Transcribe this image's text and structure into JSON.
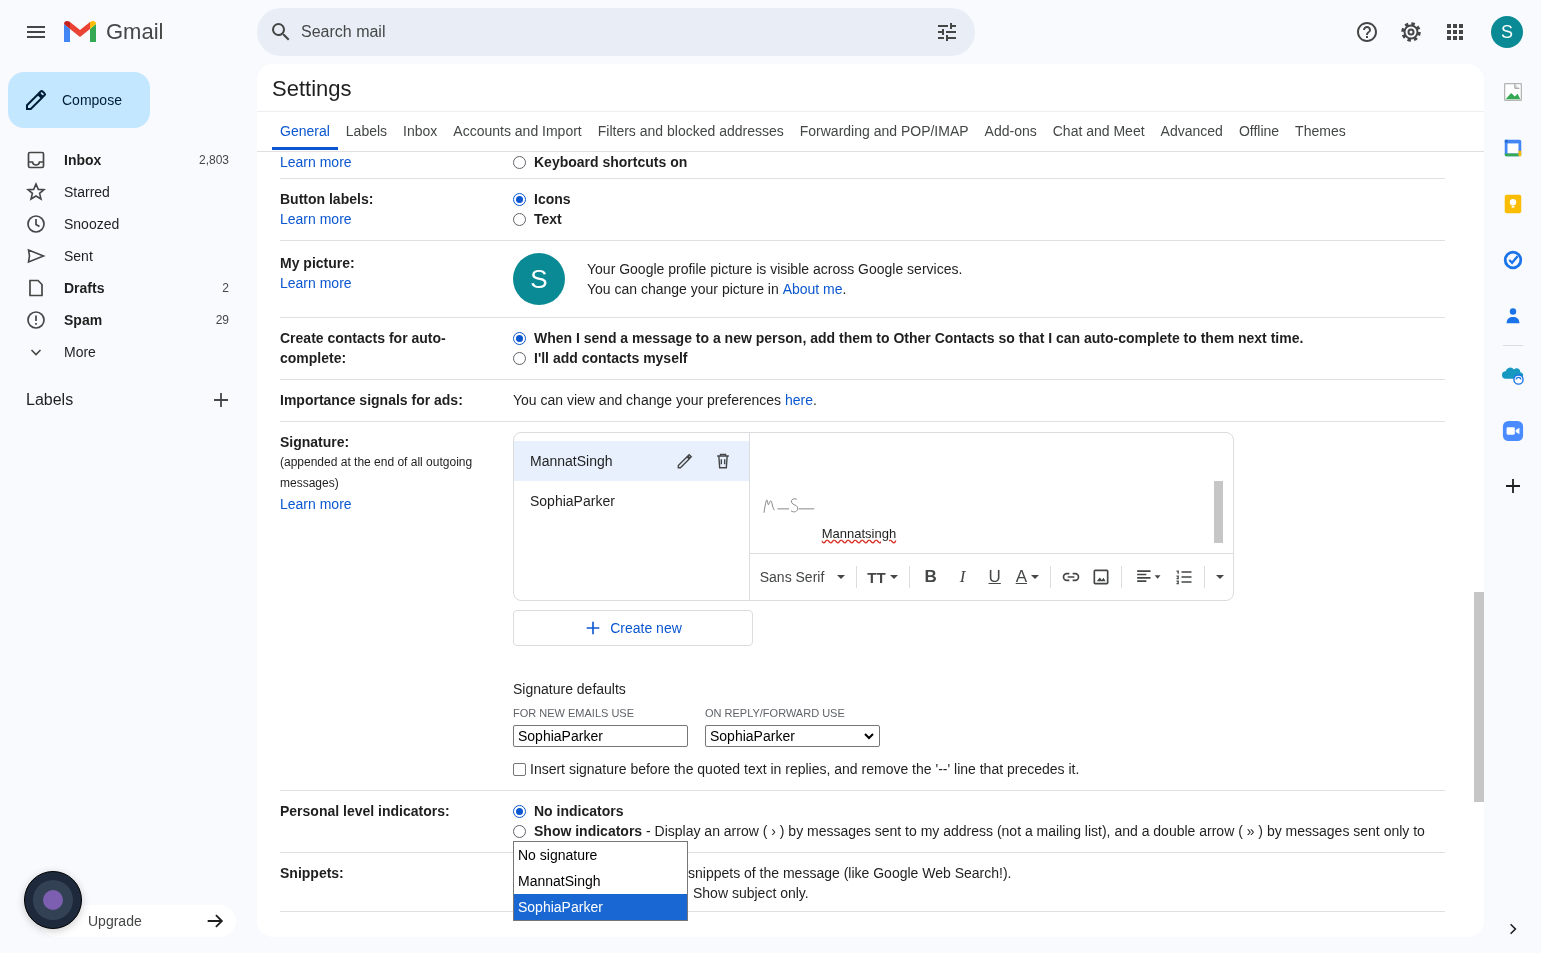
{
  "header": {
    "app_name": "Gmail",
    "search_placeholder": "Search mail",
    "avatar_letter": "S"
  },
  "compose": "Compose",
  "folders": [
    {
      "label": "Inbox",
      "count": "2,803",
      "unread": true
    },
    {
      "label": "Starred",
      "unread": false
    },
    {
      "label": "Snoozed",
      "unread": false
    },
    {
      "label": "Sent",
      "unread": false
    },
    {
      "label": "Drafts",
      "count": "2",
      "unread": true
    },
    {
      "label": "Spam",
      "count": "29",
      "unread": true
    },
    {
      "label": "More",
      "unread": false
    }
  ],
  "labels_heading": "Labels",
  "upgrade": "Upgrade",
  "settings": {
    "title": "Settings",
    "tabs": [
      {
        "label": "General",
        "selected": true
      },
      {
        "label": "Labels",
        "selected": false
      },
      {
        "label": "Inbox",
        "selected": false
      },
      {
        "label": "Accounts and Import",
        "selected": false
      },
      {
        "label": "Filters and blocked addresses",
        "selected": false
      },
      {
        "label": "Forwarding and POP/IMAP",
        "selected": false
      },
      {
        "label": "Add-ons",
        "selected": false
      },
      {
        "label": "Chat and Meet",
        "selected": false
      },
      {
        "label": "Advanced",
        "selected": false
      },
      {
        "label": "Offline",
        "selected": false
      },
      {
        "label": "Themes",
        "selected": false
      }
    ],
    "sections": [
      {
        "kind": "radio",
        "learn_more": "Learn more",
        "options": [
          {
            "text": "Keyboard shortcuts on",
            "selected": false
          }
        ]
      },
      {
        "kind": "radio",
        "label": "Button labels:",
        "learn_more": "Learn more",
        "options": [
          {
            "text": "Icons",
            "selected": true
          },
          {
            "text": "Text",
            "selected": false
          }
        ]
      },
      {
        "kind": "picture",
        "label": "My picture:",
        "learn_more": "Learn more",
        "avatar_letter": "S",
        "line": "Your Google profile picture is visible across Google services.",
        "line2_before": "You can change your picture in ",
        "line2_link": "About me",
        "line2_after": "."
      },
      {
        "kind": "radio",
        "label": "Create contacts for auto-complete:",
        "options": [
          {
            "text": "When I send a message to a new person, add them to Other Contacts so that I can auto-complete to them next time.",
            "selected": true
          },
          {
            "text": "I'll add contacts myself",
            "selected": false
          }
        ]
      },
      {
        "kind": "sentence",
        "label": "Importance signals for ads:",
        "before": "You can view and change your preferences ",
        "link": "here",
        "after": "."
      },
      {
        "kind": "signature",
        "label": "Signature:",
        "note": "(appended at the end of all outgoing messages)",
        "learn_more": "Learn more"
      },
      {
        "kind": "radio",
        "label": "Personal level indicators:",
        "options": [
          {
            "text": "No indicators",
            "selected": true
          },
          {
            "text": "**Show indicators** - Display an arrow ( › ) by messages sent to my address (not a mailing list), and a double arrow ( » ) by messages sent only to",
            "selected": false
          }
        ]
      },
      {
        "kind": "fragments",
        "label": "Snippets:",
        "fragments": [
          "snippets of the message (like Google Web Search!).",
          "Show subject only."
        ]
      }
    ]
  },
  "signature": {
    "names": [
      {
        "name": "MannatSingh",
        "selected": true
      },
      {
        "name": "SophiaParker",
        "selected": false
      }
    ],
    "body_text": "Mannatsingh",
    "font": "Sans Serif",
    "size_glyph": "TT",
    "format_glyphs": [
      "B",
      "I",
      "U",
      "A"
    ],
    "create_new": "Create new",
    "defaults_heading": "Signature defaults",
    "new_label": "FOR NEW EMAILS USE",
    "new_value": "SophiaParker",
    "reply_label": "ON REPLY/FORWARD USE",
    "reply_value": "SophiaParker",
    "open_options": [
      {
        "text": "No signature",
        "selected": false
      },
      {
        "text": "MannatSingh",
        "selected": false
      },
      {
        "text": "SophiaParker",
        "selected": true
      }
    ],
    "insert_before": {
      "text": "Insert signature before the quoted text in replies, and remove the '--' line that precedes it.",
      "checked": false
    }
  }
}
